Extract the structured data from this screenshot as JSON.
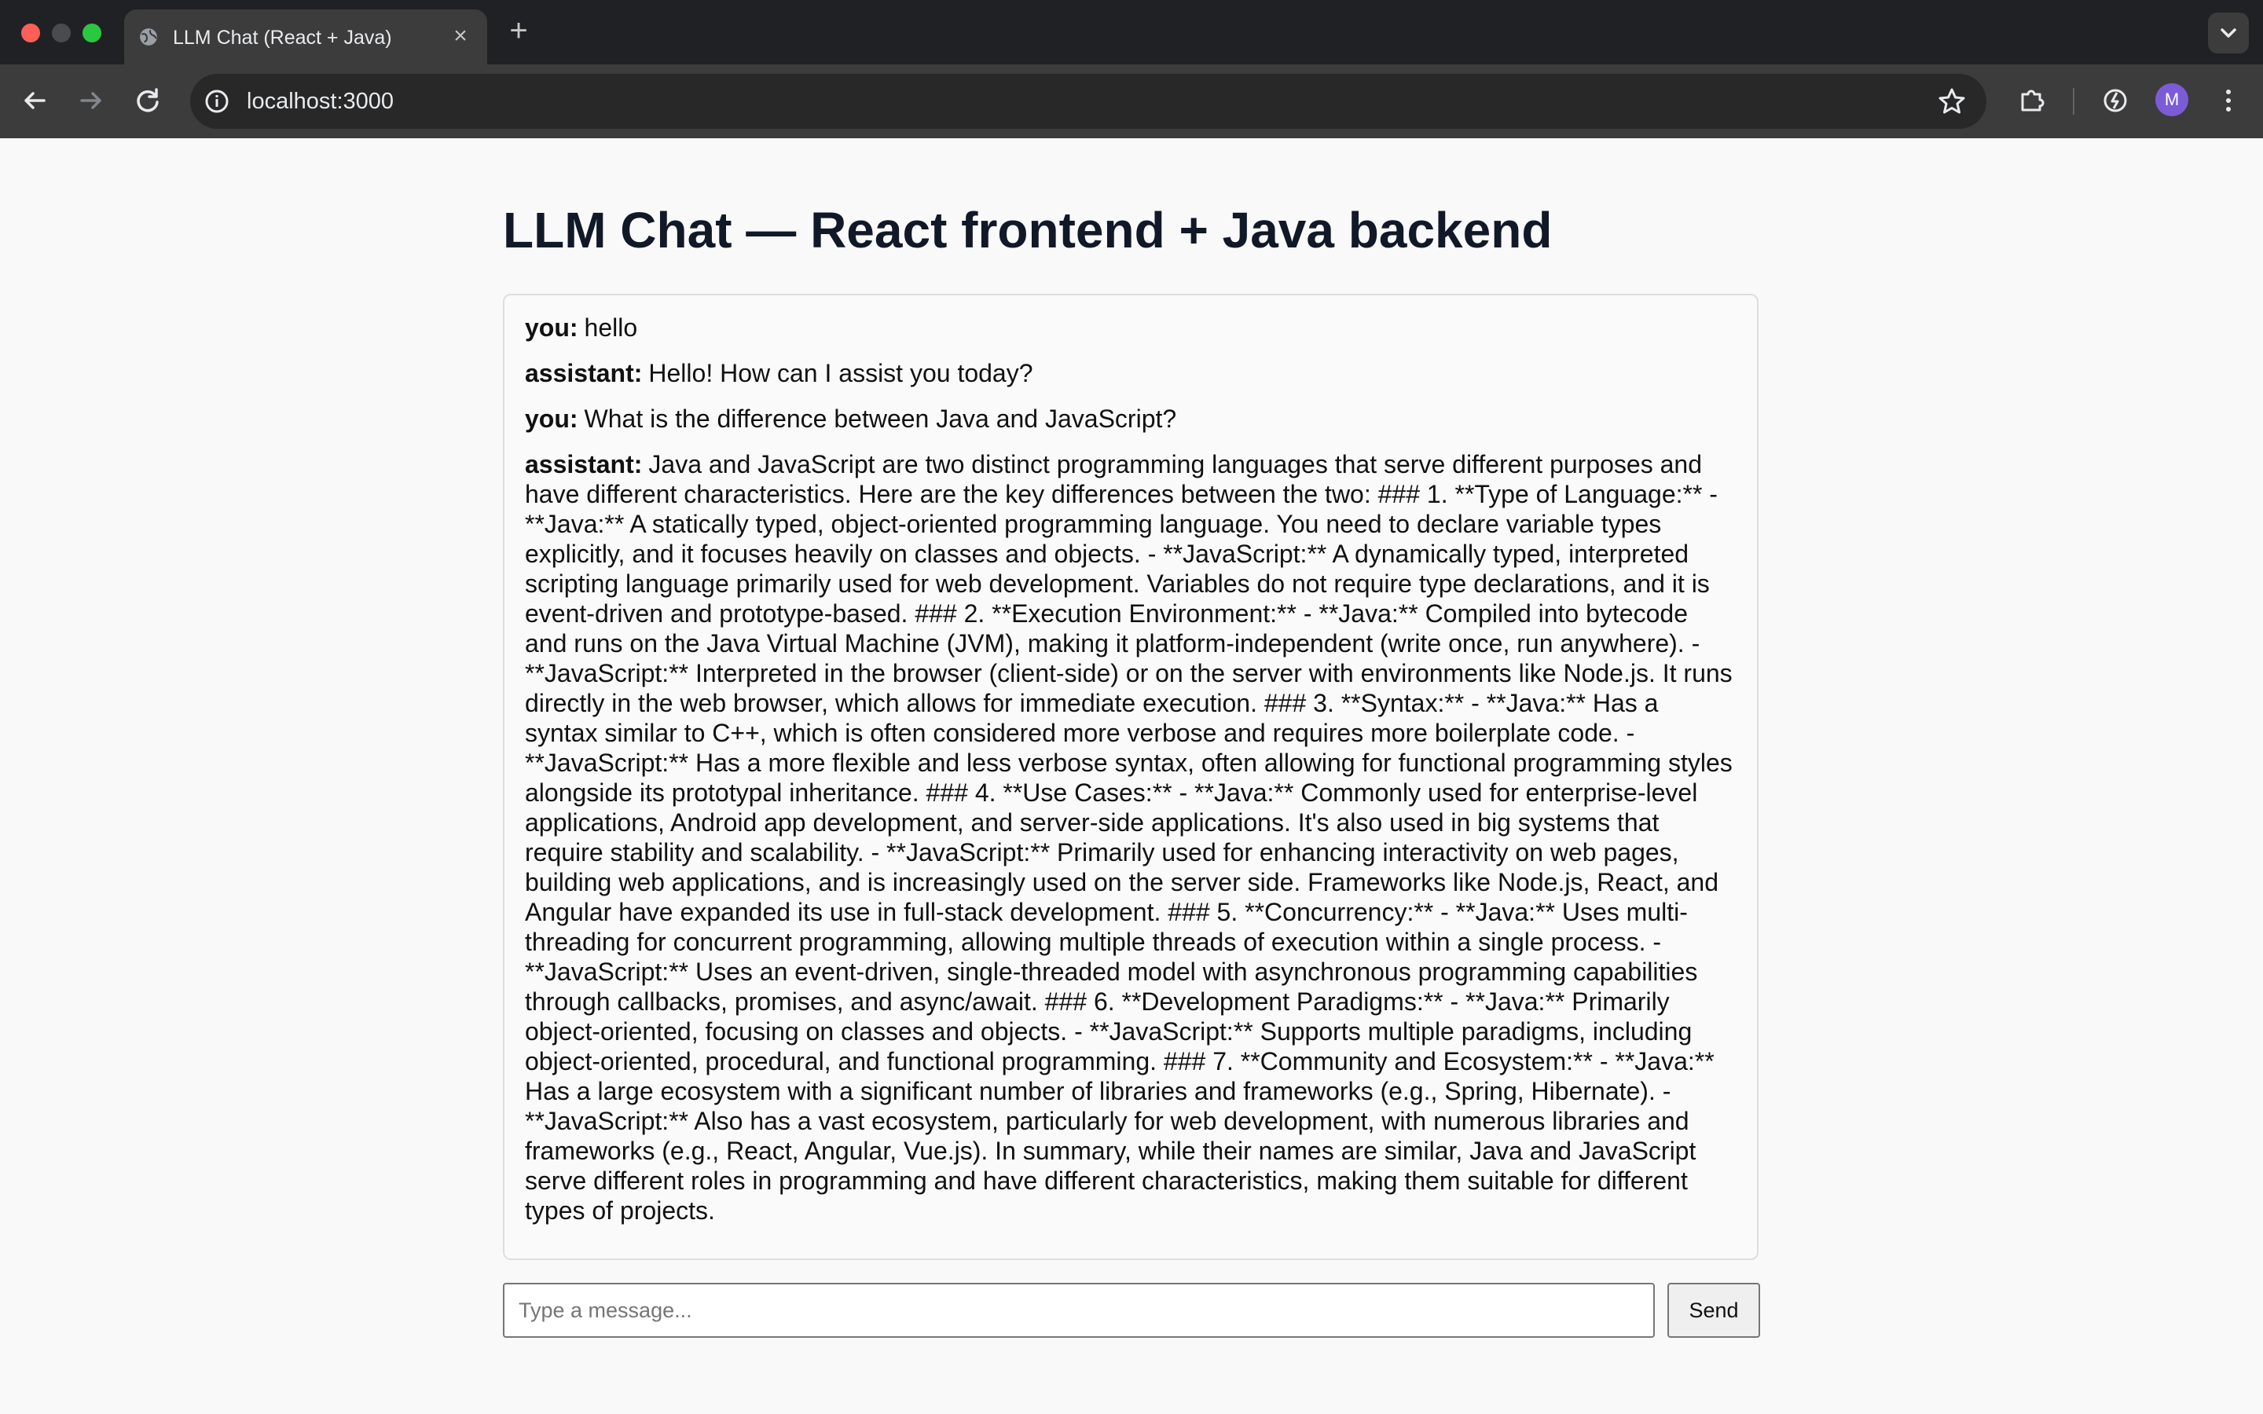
{
  "browser": {
    "tab_title": "LLM Chat (React + Java)",
    "url": "localhost:3000",
    "profile_initial": "M"
  },
  "page": {
    "title": "LLM Chat — React frontend + Java backend"
  },
  "messages": [
    {
      "role": "you:",
      "text": "hello"
    },
    {
      "role": "assistant:",
      "text": "Hello! How can I assist you today?"
    },
    {
      "role": "you:",
      "text": "What is the difference between Java and JavaScript?"
    },
    {
      "role": "assistant:",
      "text": "Java and JavaScript are two distinct programming languages that serve different purposes and have different characteristics. Here are the key differences between the two: ### 1. **Type of Language:** - **Java:** A statically typed, object-oriented programming language. You need to declare variable types explicitly, and it focuses heavily on classes and objects. - **JavaScript:** A dynamically typed, interpreted scripting language primarily used for web development. Variables do not require type declarations, and it is event-driven and prototype-based. ### 2. **Execution Environment:** - **Java:** Compiled into bytecode and runs on the Java Virtual Machine (JVM), making it platform-independent (write once, run anywhere). - **JavaScript:** Interpreted in the browser (client-side) or on the server with environments like Node.js. It runs directly in the web browser, which allows for immediate execution. ### 3. **Syntax:** - **Java:** Has a syntax similar to C++, which is often considered more verbose and requires more boilerplate code. - **JavaScript:** Has a more flexible and less verbose syntax, often allowing for functional programming styles alongside its prototypal inheritance. ### 4. **Use Cases:** - **Java:** Commonly used for enterprise-level applications, Android app development, and server-side applications. It's also used in big systems that require stability and scalability. - **JavaScript:** Primarily used for enhancing interactivity on web pages, building web applications, and is increasingly used on the server side. Frameworks like Node.js, React, and Angular have expanded its use in full-stack development. ### 5. **Concurrency:** - **Java:** Uses multi-threading for concurrent programming, allowing multiple threads of execution within a single process. - **JavaScript:** Uses an event-driven, single-threaded model with asynchronous programming capabilities through callbacks, promises, and async/await. ### 6. **Development Paradigms:** - **Java:** Primarily object-oriented, focusing on classes and objects. - **JavaScript:** Supports multiple paradigms, including object-oriented, procedural, and functional programming. ### 7. **Community and Ecosystem:** - **Java:** Has a large ecosystem with a significant number of libraries and frameworks (e.g., Spring, Hibernate). - **JavaScript:** Also has a vast ecosystem, particularly for web development, with numerous libraries and frameworks (e.g., React, Angular, Vue.js). In summary, while their names are similar, Java and JavaScript serve different roles in programming and have different characteristics, making them suitable for different types of projects."
    }
  ],
  "composer": {
    "placeholder": "Type a message...",
    "value": "",
    "send_label": "Send"
  },
  "icons": {
    "tab_favicon": "globe-icon",
    "tab_close": "close-icon",
    "new_tab": "plus-icon",
    "tab_search": "chevron-down-icon",
    "back": "arrow-left-icon",
    "forward": "arrow-right-icon",
    "reload": "reload-icon",
    "site_info": "info-icon",
    "bookmark": "star-icon",
    "extensions": "puzzle-icon",
    "performance": "gauge-icon"
  },
  "colors": {
    "chrome_dark": "#202124",
    "toolbar": "#3c3c3c",
    "page_bg": "#f9f9f9",
    "title": "#111827",
    "avatar": "#7c5cd6"
  }
}
